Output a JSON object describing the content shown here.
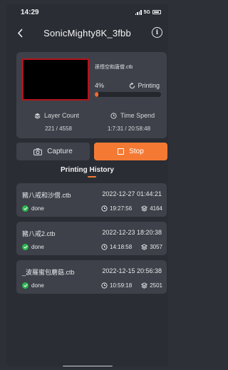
{
  "status_bar": {
    "time": "14:29",
    "network": "5G"
  },
  "header": {
    "title": "SonicMighty8K_3fbb"
  },
  "job": {
    "file_name": "孫悟空和唐僧.ctb",
    "progress_text": "4%",
    "progress_value": 0.04,
    "state": "Printing",
    "layer_count_label": "Layer Count",
    "layer_count_value": "221 / 4558",
    "time_spend_label": "Time Spend",
    "time_spend_value": "1:7:31 / 20:58:48"
  },
  "actions": {
    "capture_label": "Capture",
    "stop_label": "Stop"
  },
  "history": {
    "title": "Printing History",
    "items": [
      {
        "name": "豬八戒和沙僧.ctb",
        "date": "2022-12-27 01:44:21",
        "status": "done",
        "duration": "19:27:56",
        "layers": "4164"
      },
      {
        "name": "豬八戒2.ctb",
        "date": "2022-12-23 18:20:38",
        "status": "done",
        "duration": "14:18:58",
        "layers": "3057"
      },
      {
        "name": "_波羅蜜包蘑菇.ctb",
        "date": "2022-12-15 20:56:38",
        "status": "done",
        "duration": "10:59:18",
        "layers": "2501"
      }
    ]
  },
  "colors": {
    "accent": "#f47a34",
    "done": "#2ab84e",
    "card": "#3e4149",
    "background": "#2a2d33"
  },
  "icons": [
    "back-arrow-icon",
    "info-icon",
    "refresh-icon",
    "layers-icon",
    "clock-icon",
    "camera-icon",
    "stop-icon",
    "check-circle-icon"
  ]
}
